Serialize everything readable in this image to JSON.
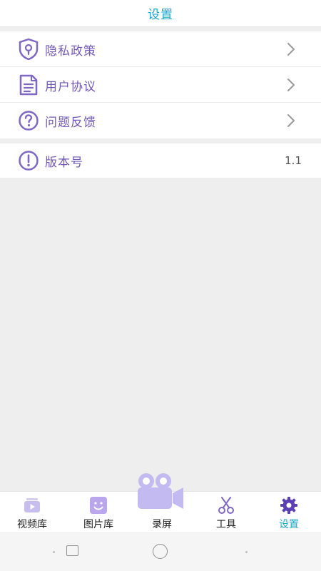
{
  "header": {
    "title": "设置"
  },
  "settings": {
    "items": [
      {
        "label": "隐私政策",
        "icon": "privacy-shield-icon"
      },
      {
        "label": "用户协议",
        "icon": "document-icon"
      },
      {
        "label": "问题反馈",
        "icon": "question-circle-icon"
      }
    ],
    "version": {
      "label": "版本号",
      "value": "1.1",
      "icon": "exclamation-circle-icon"
    }
  },
  "bottom_nav": {
    "items": [
      {
        "label": "视频库",
        "icon": "video-library-icon",
        "active": false
      },
      {
        "label": "图片库",
        "icon": "image-library-icon",
        "active": false
      },
      {
        "label": "录屏",
        "icon": "video-camera-icon",
        "active": false
      },
      {
        "label": "工具",
        "icon": "scissors-icon",
        "active": false
      },
      {
        "label": "设置",
        "icon": "gear-icon",
        "active": true
      }
    ]
  },
  "colors": {
    "accent": "#1aa6c8",
    "label": "#7258b8",
    "icon": "#7f68c4",
    "background": "#eeeeee"
  }
}
